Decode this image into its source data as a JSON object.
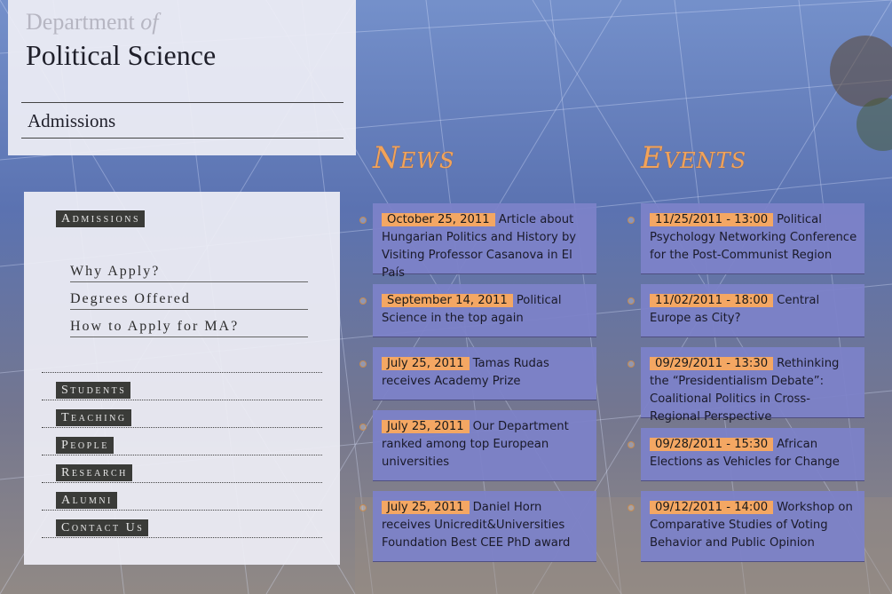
{
  "header": {
    "dept_prefix": "Department",
    "dept_of": "of",
    "title": "Political Science",
    "section": "Admissions"
  },
  "sidebar": {
    "active_heading": "Admissions",
    "sub_items": [
      "Why Apply?",
      "Degrees Offered",
      "How to Apply for MA?"
    ],
    "nav": [
      "Students",
      "Teaching",
      "People",
      "Research",
      "Alumni",
      "Contact Us"
    ]
  },
  "news": {
    "heading": "News",
    "items": [
      {
        "date": "October 25, 2011",
        "text": "Article about Hungarian Politics and History by Visiting Professor Casanova in El País"
      },
      {
        "date": "September 14, 2011",
        "text": "Political Science in the top again"
      },
      {
        "date": "July 25, 2011",
        "text": "Tamas Rudas receives Academy Prize"
      },
      {
        "date": "July 25, 2011",
        "text": "Our Department ranked among top European universities"
      },
      {
        "date": "July 25, 2011",
        "text": "Daniel Horn receives Unicredit&Universities Foundation Best CEE PhD award"
      }
    ]
  },
  "events": {
    "heading": "Events",
    "items": [
      {
        "date": "11/25/2011 - 13:00",
        "text": "Political Psychology Networking Conference for the Post-Communist Region"
      },
      {
        "date": "11/02/2011 - 18:00",
        "text": "Central Europe as City?"
      },
      {
        "date": "09/29/2011 - 13:30",
        "text": "Rethinking the “Presidentialism Debate”: Coalitional Politics in Cross-Regional Perspective"
      },
      {
        "date": "09/28/2011 - 15:30",
        "text": "African Elections as Vehicles for Change"
      },
      {
        "date": "09/12/2011 - 14:00",
        "text": "Workshop on Comparative Studies of Voting Behavior and Public Opinion"
      }
    ]
  },
  "colors": {
    "accent": "#f4a763",
    "card_bg": "#7c82c8",
    "nav_bg": "#3a3b38"
  }
}
